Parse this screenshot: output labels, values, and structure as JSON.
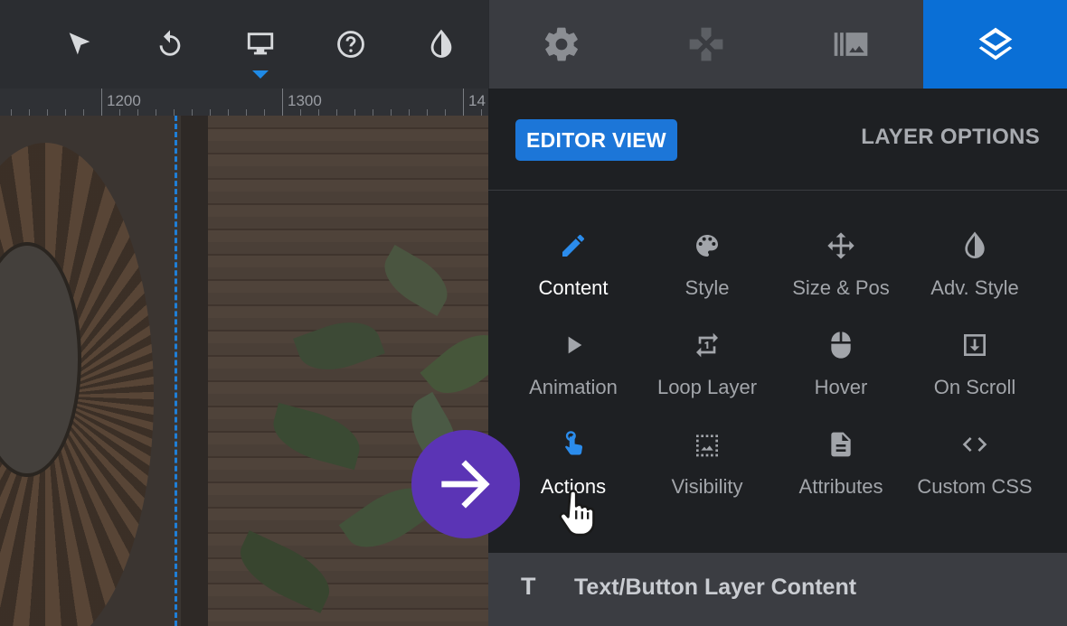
{
  "toolbar": {
    "icons": [
      "cursor-arrow-icon",
      "undo-icon",
      "desktop-icon",
      "help-icon",
      "contrast-icon"
    ],
    "active_device": "desktop"
  },
  "right_tabs": {
    "icons": [
      "gear-icon",
      "puzzle-icon",
      "media-library-icon",
      "layers-icon"
    ],
    "active": "layers"
  },
  "ruler": {
    "labels": [
      "1200",
      "1300",
      "14"
    ]
  },
  "panel": {
    "editor_view": "EDITOR VIEW",
    "layer_options": "LAYER OPTIONS",
    "options": [
      {
        "label": "Content",
        "icon": "pencil-icon",
        "active": true
      },
      {
        "label": "Style",
        "icon": "palette-icon",
        "active": false
      },
      {
        "label": "Size & Pos",
        "icon": "move-icon",
        "active": false
      },
      {
        "label": "Adv. Style",
        "icon": "contrast-icon",
        "active": false
      },
      {
        "label": "Animation",
        "icon": "play-icon",
        "active": false
      },
      {
        "label": "Loop Layer",
        "icon": "loop-icon",
        "active": false
      },
      {
        "label": "Hover",
        "icon": "mouse-icon",
        "active": false
      },
      {
        "label": "On Scroll",
        "icon": "scroll-download-icon",
        "active": false
      },
      {
        "label": "Actions",
        "icon": "tap-finger-icon",
        "active": true
      },
      {
        "label": "Visibility",
        "icon": "visibility-image-icon",
        "active": false
      },
      {
        "label": "Attributes",
        "icon": "document-icon",
        "active": false
      },
      {
        "label": "Custom CSS",
        "icon": "code-icon",
        "active": false
      }
    ],
    "footer": {
      "icon_text": "T",
      "label": "Text/Button Layer Content"
    }
  },
  "colors": {
    "accent": "#1c76d8",
    "active_tab": "#0a6fd6",
    "overlay_arrow": "#5b34b5"
  }
}
